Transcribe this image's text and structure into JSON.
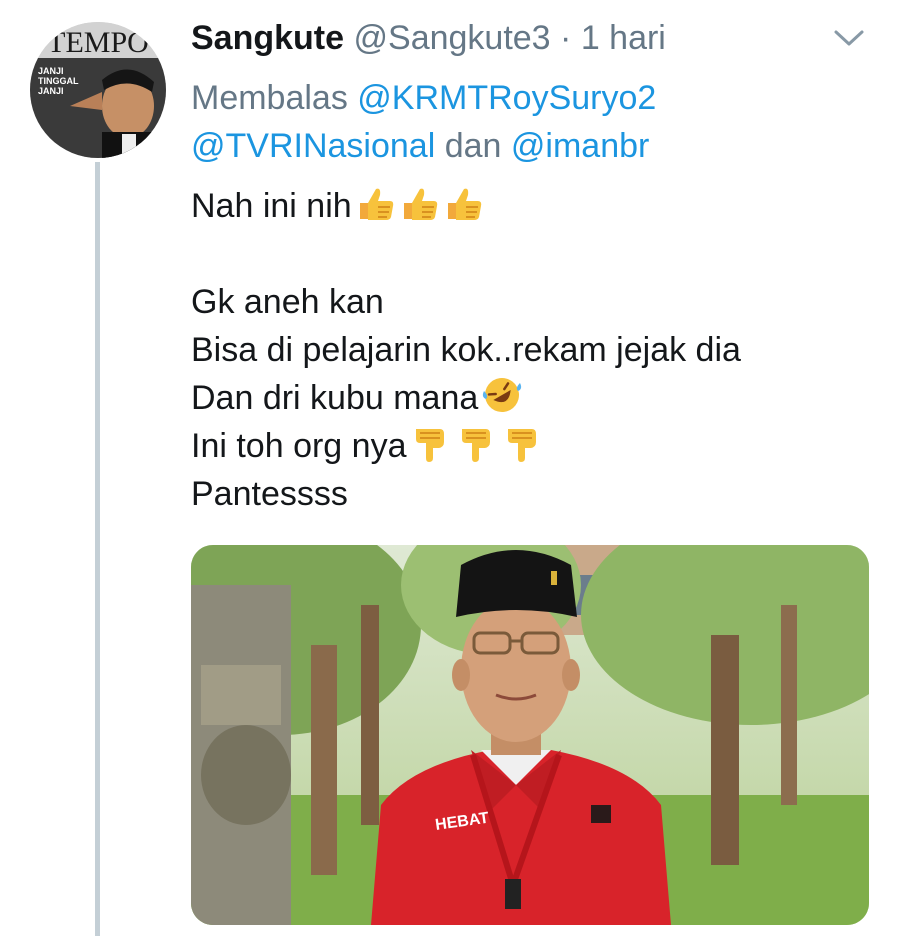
{
  "avatar": {
    "masthead": "TEMPO",
    "cover_lines": [
      "JANJI",
      "TINGGAL",
      "JANJI"
    ]
  },
  "tweet": {
    "name": "Sangkute",
    "handle": "@Sangkute3",
    "separator": " · ",
    "time": "1 hari",
    "reply": {
      "prefix": "Membalas ",
      "mention1": "@KRMTRoySuryo2",
      "mention2": "@TVRINasional",
      "conjunction": " dan ",
      "mention3": "@imanbr"
    },
    "lines": [
      "Nah ini nih",
      "",
      "Gk aneh kan",
      "Bisa di pelajarin kok..rekam jejak dia",
      "Dan dri kubu mana",
      "Ini toh org nya",
      "Pantessss"
    ],
    "emojis": {
      "line1": "thumbs-up x3",
      "line5": "rolling-on-floor-laughing",
      "line6": "pointing-down x3"
    },
    "photo": {
      "shirt_text": "HEBAT"
    }
  },
  "colors": {
    "text": "#14171a",
    "secondary": "#657786",
    "link": "#1b95e0",
    "thread_line": "#c4cfd6",
    "shirt": "#d8232a"
  }
}
